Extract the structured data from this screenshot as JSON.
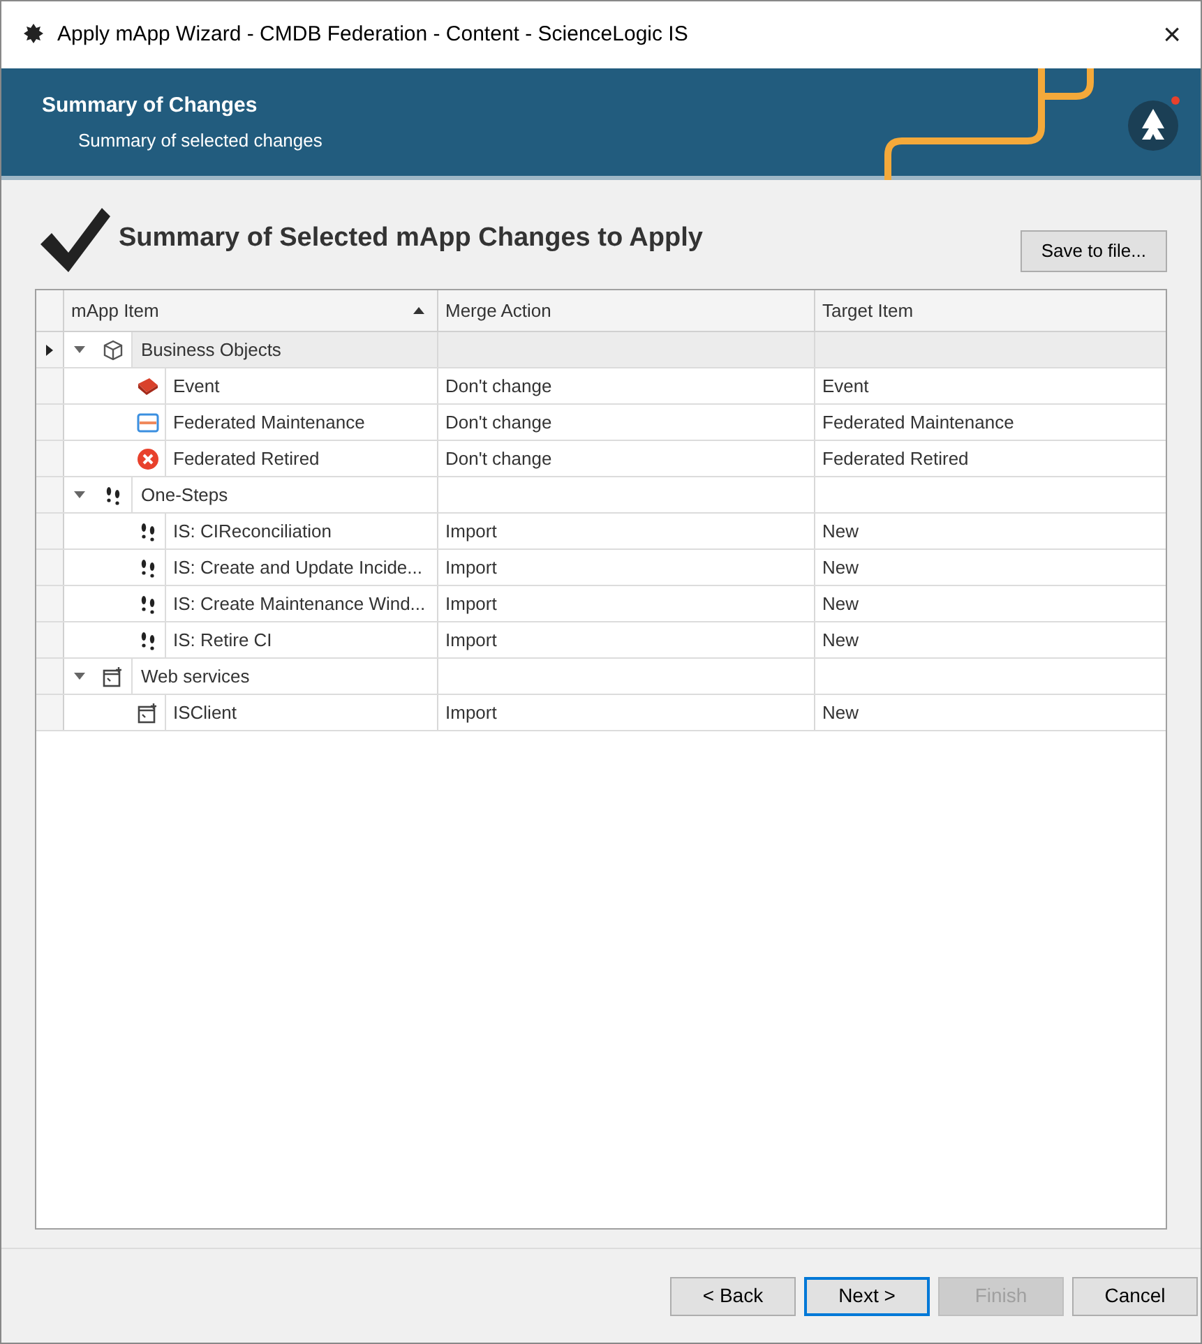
{
  "window": {
    "title": "Apply mApp Wizard - CMDB Federation - Content - ScienceLogic IS",
    "close": "×"
  },
  "header": {
    "title": "Summary of Changes",
    "subtitle": "Summary of selected changes"
  },
  "page_heading": "Summary of Selected mApp Changes to Apply",
  "save_button": "Save to file...",
  "table": {
    "columns": [
      {
        "label": "mApp Item",
        "sorted": true
      },
      {
        "label": "Merge Action",
        "sorted": false
      },
      {
        "label": "Target Item",
        "sorted": false
      }
    ],
    "rows": [
      {
        "kind": "business",
        "label": "Business Objects",
        "expanded": true,
        "selected": true,
        "children": [
          {
            "kind": "event",
            "label": "Event",
            "merge_action": "Don't change",
            "target": "Event",
            "selected": false
          },
          {
            "kind": "maintenance",
            "label": "Federated Maintenance",
            "merge_action": "Don't change",
            "target": "Federated Maintenance",
            "selected": false
          },
          {
            "kind": "retired",
            "label": "Federated Retired",
            "merge_action": "Don't change",
            "target": "Federated Retired",
            "selected": false
          }
        ]
      },
      {
        "kind": "onestep",
        "label": "One-Steps",
        "expanded": true,
        "selected": false,
        "children": [
          {
            "kind": "onestep",
            "label": "IS: CIReconciliation",
            "merge_action": "Import",
            "target": "New",
            "selected": false
          },
          {
            "kind": "onestep",
            "label": "IS: Create and Update Incide...",
            "merge_action": "Import",
            "target": "New",
            "selected": false
          },
          {
            "kind": "onestep",
            "label": "IS: Create Maintenance Wind...",
            "merge_action": "Import",
            "target": "New",
            "selected": false
          },
          {
            "kind": "onestep",
            "label": "IS: Retire CI",
            "merge_action": "Import",
            "target": "New",
            "selected": false
          }
        ]
      },
      {
        "kind": "webservice",
        "label": "Web services",
        "expanded": true,
        "selected": false,
        "children": [
          {
            "kind": "webservice",
            "label": "ISClient",
            "merge_action": "Import",
            "target": "New",
            "selected": false
          }
        ]
      }
    ]
  },
  "buttons": [
    {
      "label": "< Back",
      "disabled": false,
      "default": false
    },
    {
      "label": "Next >",
      "disabled": false,
      "default": true
    },
    {
      "label": "Finish",
      "disabled": true,
      "default": false
    },
    {
      "label": "Cancel",
      "disabled": false,
      "default": false
    }
  ]
}
